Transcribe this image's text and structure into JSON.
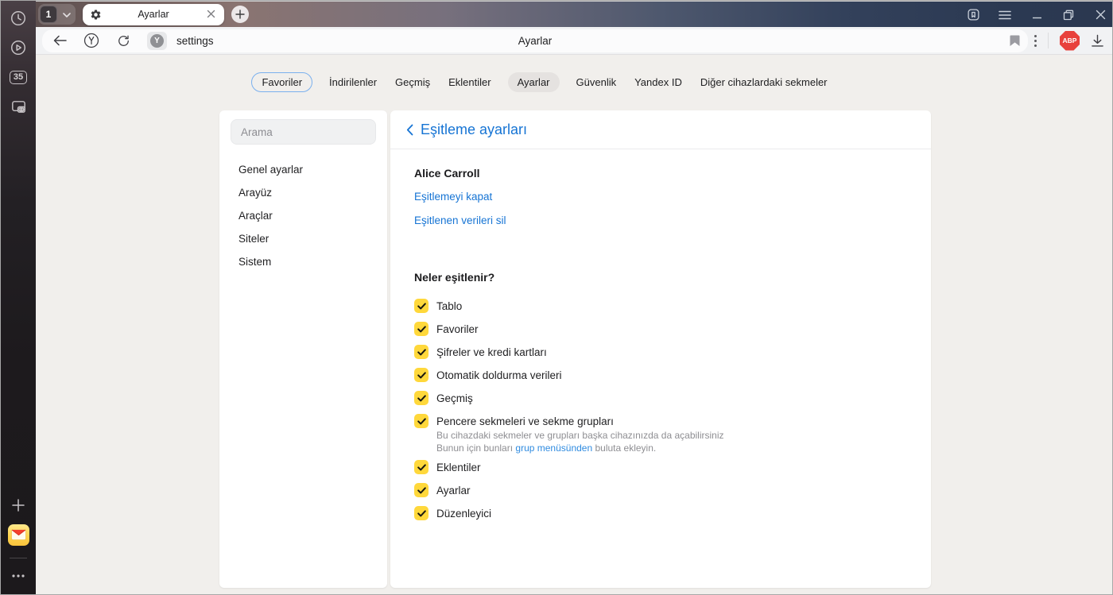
{
  "browser": {
    "tab_count": "1",
    "sidebar_tab_badge": "35",
    "active_tab": {
      "title": "Ayarlar"
    },
    "address_bar": {
      "url": "settings",
      "page_title": "Ayarlar"
    },
    "adblock_label": "ABP"
  },
  "nav_tabs": [
    {
      "label": "Favoriler",
      "state": "outlined"
    },
    {
      "label": "İndirilenler",
      "state": "plain"
    },
    {
      "label": "Geçmiş",
      "state": "plain"
    },
    {
      "label": "Eklentiler",
      "state": "plain"
    },
    {
      "label": "Ayarlar",
      "state": "selected"
    },
    {
      "label": "Güvenlik",
      "state": "plain"
    },
    {
      "label": "Yandex ID",
      "state": "plain"
    },
    {
      "label": "Diğer cihazlardaki sekmeler",
      "state": "plain"
    }
  ],
  "settings_nav": {
    "search_placeholder": "Arama",
    "items": [
      {
        "label": "Genel ayarlar"
      },
      {
        "label": "Arayüz"
      },
      {
        "label": "Araçlar"
      },
      {
        "label": "Siteler"
      },
      {
        "label": "Sistem"
      }
    ]
  },
  "sync_page": {
    "title": "Eşitleme ayarları",
    "account_name": "Alice Carroll",
    "link_disable": "Eşitlemeyi kapat",
    "link_delete": "Eşitlenen verileri sil",
    "section_title": "Neler eşitlenir?",
    "items": [
      {
        "label": "Tablo",
        "checked": true
      },
      {
        "label": "Favoriler",
        "checked": true
      },
      {
        "label": "Şifreler ve kredi kartları",
        "checked": true
      },
      {
        "label": "Otomatik doldurma verileri",
        "checked": true
      },
      {
        "label": "Geçmiş",
        "checked": true
      },
      {
        "label": "Pencere sekmeleri ve sekme grupları",
        "checked": true,
        "description_line1": "Bu cihazdaki sekmeler ve grupları başka cihazınızda da açabilirsiniz",
        "description_line2_prefix": "Bunun için bunları ",
        "description_line2_link": "grup menüsünden",
        "description_line2_suffix": " buluta ekleyin."
      },
      {
        "label": "Eklentiler",
        "checked": true
      },
      {
        "label": "Ayarlar",
        "checked": true
      },
      {
        "label": "Düzenleyici",
        "checked": true
      }
    ]
  },
  "colors": {
    "accent_blue": "#1674d4",
    "checkbox_yellow": "#ffd83b",
    "adblock_red": "#e8413c",
    "selected_pill_bg": "#e5e2e0"
  }
}
